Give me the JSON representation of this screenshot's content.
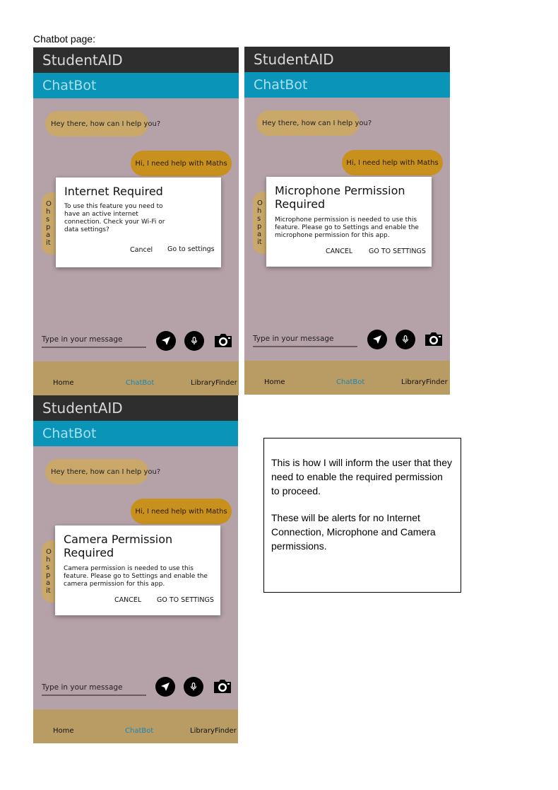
{
  "heading": "Chatbot page:",
  "screens": [
    {
      "app_title": "StudentAID",
      "page_title": "ChatBot",
      "bot_greeting": "Hey there, how can I help you?",
      "user_message": "Hi, I need help with Maths",
      "hidden_reply_letters": [
        "O",
        "h",
        "s",
        "p",
        "a",
        "it"
      ],
      "dialog": {
        "title": "Internet Required",
        "body": "To use this feature you need to have an active internet connection. Check your Wi-Fi or data settings?",
        "cancel": "Cancel",
        "confirm": "Go to settings"
      },
      "input_placeholder": "Type in your message",
      "nav": [
        "Home",
        "ChatBot",
        "LibraryFinder"
      ]
    },
    {
      "app_title": "StudentAID",
      "page_title": "ChatBot",
      "bot_greeting": "Hey there, how can I help you?",
      "user_message": "Hi, I need help with Maths",
      "hidden_reply_letters": [
        "O",
        "h",
        "s",
        "p",
        "a",
        "it"
      ],
      "dialog": {
        "title": "Microphone Permission Required",
        "body": "Microphone permission is needed to use this feature. Please go to Settings and enable the microphone permission for this app.",
        "cancel": "CANCEL",
        "confirm": "GO TO SETTINGS"
      },
      "input_placeholder": "Type in your message",
      "nav": [
        "Home",
        "ChatBot",
        "LibraryFinder"
      ]
    },
    {
      "app_title": "StudentAID",
      "page_title": "ChatBot",
      "bot_greeting": "Hey there, how can I help you?",
      "user_message": "Hi, I need help with Maths",
      "hidden_reply_letters": [
        "O",
        "h",
        "s",
        "p",
        "a",
        "it"
      ],
      "dialog": {
        "title": "Camera Permission Required",
        "body": "Camera permission is needed to use this feature. Please go to Settings and enable the camera permission for this app.",
        "cancel": "CANCEL",
        "confirm": "GO TO SETTINGS"
      },
      "input_placeholder": "Type in your message",
      "nav": [
        "Home",
        "ChatBot",
        "LibraryFinder"
      ]
    }
  ],
  "icons": {
    "send": "send-icon",
    "mic": "microphone-icon",
    "camera": "camera-icon"
  },
  "colors": {
    "app_bar": "#2e2e2e",
    "chatbot_bar": "#0994b8",
    "chat_background": "#b5a1a8",
    "bot_bubble": "#c9a86a",
    "user_bubble": "#c8901d",
    "bottom_nav": "#b89c63",
    "active_nav": "#1b86b8"
  },
  "note": {
    "paragraph1": "This is how I will inform the user that they need to enable the required permission to proceed.",
    "paragraph2": "These will be alerts for no Internet Connection, Microphone and Camera permissions."
  }
}
